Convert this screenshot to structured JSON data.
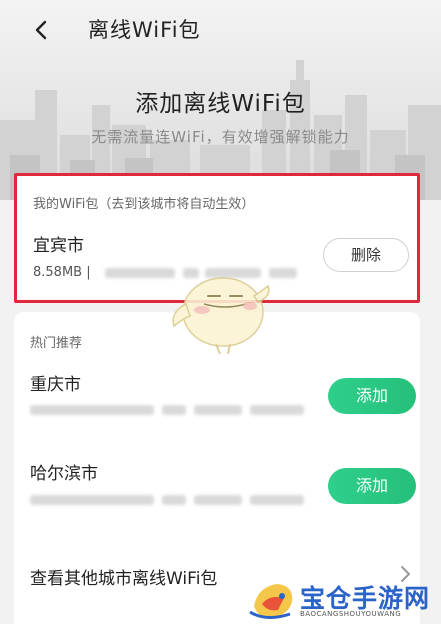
{
  "header": {
    "nav_title": "离线WiFi包",
    "title": "添加离线WiFi包",
    "subtitle": "无需流量连WiFi，有效增强解锁能力"
  },
  "my_wifi": {
    "section_label": "我的WiFi包（去到该城市将自动生效）",
    "city": "宜宾市",
    "size": "8.58MB |",
    "delete_label": "删除"
  },
  "hot": {
    "section_label": "热门推荐",
    "items": [
      {
        "city": "重庆市",
        "add_label": "添加"
      },
      {
        "city": "哈尔滨市",
        "add_label": "添加"
      }
    ],
    "more_label": "查看其他城市离线WiFi包"
  },
  "watermark": {
    "text": "宝仓手游网",
    "sub": "BAOCANGSHOUYOUWANG"
  },
  "colors": {
    "accent_green": "#2fcf8c",
    "highlight_red": "#e0283a",
    "watermark_blue": "#2a64c8"
  },
  "icons": [
    "back-icon",
    "chevron-right-icon",
    "mascot-icon",
    "logo-icon"
  ]
}
